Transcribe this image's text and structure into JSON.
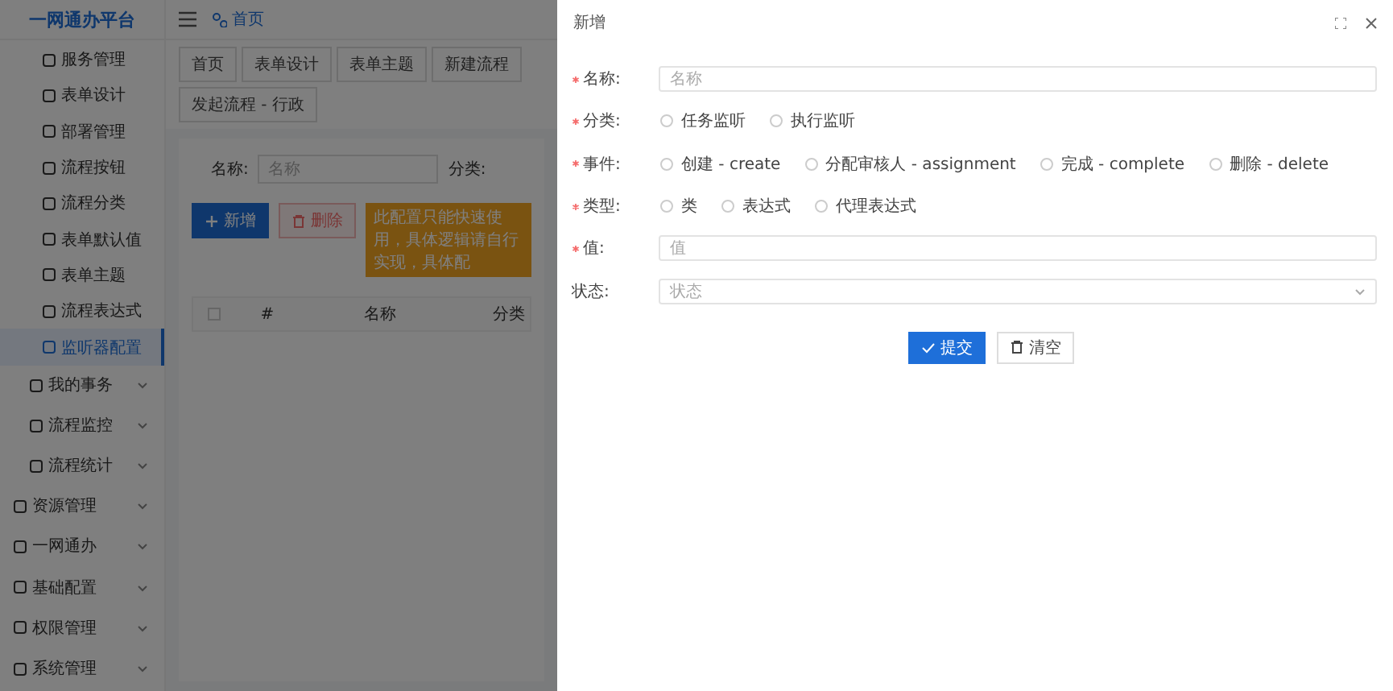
{
  "sidebar": {
    "title": "一网通办平台",
    "items": [
      {
        "label": "服务管理",
        "kind": "child",
        "selected": false
      },
      {
        "label": "表单设计",
        "kind": "child",
        "selected": false
      },
      {
        "label": "部署管理",
        "kind": "child",
        "selected": false
      },
      {
        "label": "流程按钮",
        "kind": "child",
        "selected": false
      },
      {
        "label": "流程分类",
        "kind": "child",
        "selected": false
      },
      {
        "label": "表单默认值",
        "kind": "child",
        "selected": false
      },
      {
        "label": "表单主题",
        "kind": "child",
        "selected": false
      },
      {
        "label": "流程表达式",
        "kind": "child",
        "selected": false
      },
      {
        "label": "监听器配置",
        "kind": "child",
        "selected": true
      },
      {
        "label": "我的事务",
        "kind": "subgroup",
        "selected": false
      },
      {
        "label": "流程监控",
        "kind": "subgroup",
        "selected": false
      },
      {
        "label": "流程统计",
        "kind": "subgroup",
        "selected": false
      },
      {
        "label": "资源管理",
        "kind": "group",
        "selected": false
      },
      {
        "label": "一网通办",
        "kind": "group",
        "selected": false
      },
      {
        "label": "基础配置",
        "kind": "group",
        "selected": false
      },
      {
        "label": "权限管理",
        "kind": "group",
        "selected": false
      },
      {
        "label": "系统管理",
        "kind": "group",
        "selected": false
      }
    ]
  },
  "header": {
    "breadcrumb": "首页"
  },
  "tabs": [
    {
      "label": "首页",
      "selected": false
    },
    {
      "label": "表单设计",
      "selected": false
    },
    {
      "label": "表单主题",
      "selected": false
    },
    {
      "label": "新建流程",
      "selected": false
    },
    {
      "label": "发起流程 - 行政",
      "selected": false
    }
  ],
  "search": {
    "fields": [
      {
        "label": "名称:",
        "placeholder": "名称"
      },
      {
        "label": "分类:"
      }
    ]
  },
  "toolbar": {
    "buttons": [
      {
        "label": "新增",
        "kind": "primary"
      },
      {
        "label": "删除",
        "kind": "danger"
      }
    ],
    "notice": "此配置只能快速使用，具体逻辑请自行实现，具体配"
  },
  "table": {
    "columns": [
      "#",
      "名称",
      "分类"
    ]
  },
  "drawer": {
    "title": "新增",
    "fields": [
      {
        "label": "名称:",
        "required": true,
        "kind": "input",
        "placeholder": "名称"
      },
      {
        "label": "分类:",
        "required": true,
        "kind": "radio",
        "options": [
          {
            "label": "任务监听",
            "checked": false
          },
          {
            "label": "执行监听",
            "checked": false
          }
        ]
      },
      {
        "label": "事件:",
        "required": true,
        "kind": "radio",
        "options": [
          {
            "label": "创建 - create",
            "checked": false
          },
          {
            "label": "分配审核人 - assignment",
            "checked": false
          },
          {
            "label": "完成 - complete",
            "checked": false
          },
          {
            "label": "删除 - delete",
            "checked": false
          }
        ]
      },
      {
        "label": "类型:",
        "required": true,
        "kind": "radio",
        "options": [
          {
            "label": "类",
            "checked": false
          },
          {
            "label": "表达式",
            "checked": false
          },
          {
            "label": "代理表达式",
            "checked": false
          }
        ]
      },
      {
        "label": "值:",
        "required": true,
        "kind": "input",
        "placeholder": "值"
      },
      {
        "label": "状态:",
        "required": false,
        "kind": "select",
        "placeholder": "状态"
      }
    ],
    "buttons": [
      {
        "label": "提交",
        "kind": "primary"
      },
      {
        "label": "清空",
        "kind": "plain"
      }
    ]
  }
}
